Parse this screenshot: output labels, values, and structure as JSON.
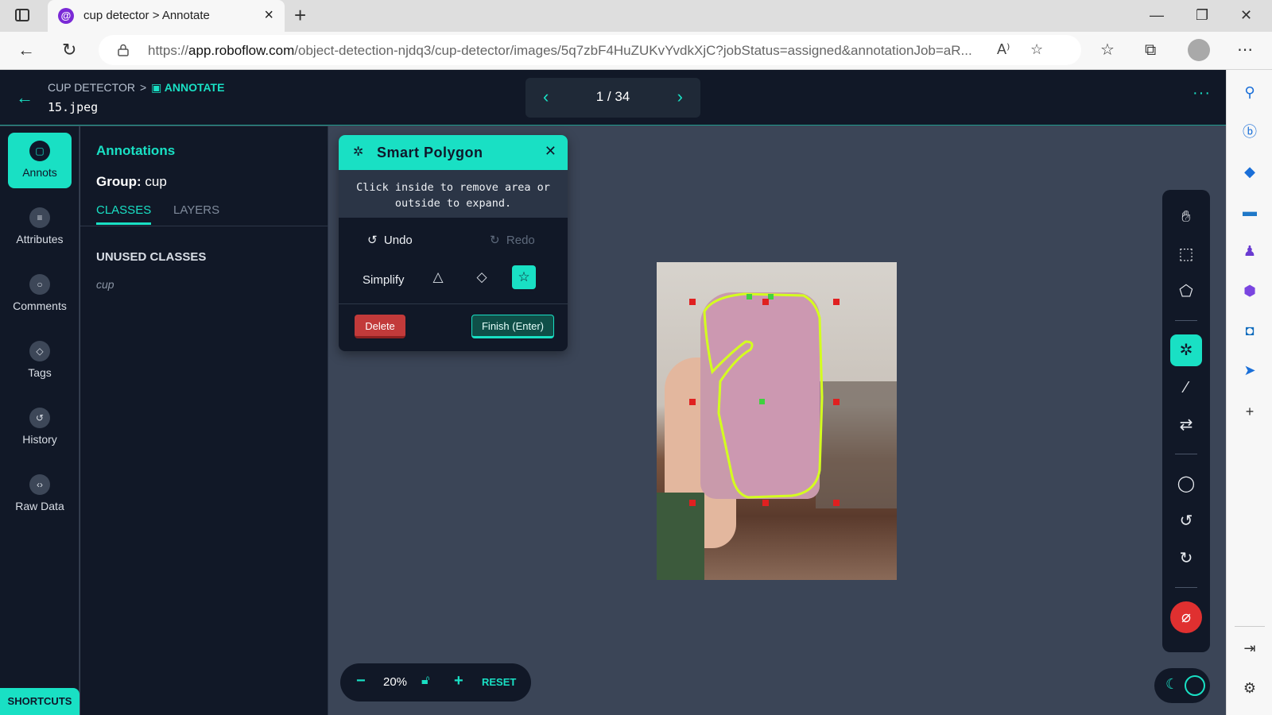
{
  "browser": {
    "tab_title": "cup detector > Annotate",
    "favicon_glyph": "@",
    "url_prefix": "https://",
    "url_host": "app.roboflow.com",
    "url_path": "/object-detection-njdq3/cup-detector/images/5q7zbF4HuZUKvYvdkXjC?jobStatus=assigned&annotationJob=aR...",
    "nav_icons": [
      "back-arrow-icon",
      "refresh-icon",
      "lock-icon"
    ],
    "window_controls": [
      "minimize",
      "restore",
      "close"
    ]
  },
  "header": {
    "project": "CUP DETECTOR",
    "separator": ">",
    "section": "ANNOTATE",
    "filename": "15.jpeg",
    "pager": "1 / 34"
  },
  "leftnav": {
    "items": [
      {
        "label": "Annots",
        "active": true
      },
      {
        "label": "Attributes",
        "active": false
      },
      {
        "label": "Comments",
        "active": false
      },
      {
        "label": "Tags",
        "active": false
      },
      {
        "label": "History",
        "active": false
      },
      {
        "label": "Raw Data",
        "active": false
      }
    ],
    "shortcuts": "SHORTCUTS"
  },
  "panel": {
    "title": "Annotations",
    "group_label": "Group:",
    "group_value": "cup",
    "tabs": [
      "CLASSES",
      "LAYERS"
    ],
    "unused_heading": "UNUSED CLASSES",
    "classes": [
      "cup"
    ]
  },
  "smart_polygon": {
    "title": "Smart Polygon",
    "message_line1": "Click inside to remove area or",
    "message_line2": "outside to expand.",
    "undo": "Undo",
    "redo": "Redo",
    "simplify": "Simplify",
    "delete": "Delete",
    "finish": "Finish (Enter)"
  },
  "zoom": {
    "value": "20%",
    "reset": "RESET"
  },
  "colors": {
    "accent": "#19e0c4",
    "header_bg": "#111827",
    "canvas_bg": "#3b4557",
    "danger": "#e03030"
  },
  "toolbar_icons": [
    "hand-icon",
    "bounding-box-icon",
    "polygon-icon",
    "smart-polygon-icon",
    "magic-wand-icon",
    "repeat-icon",
    "comment-icon",
    "undo-icon",
    "redo-icon",
    "hide-icon"
  ],
  "edge_sidebar_icons": [
    "search-icon",
    "bing-icon",
    "tag-icon",
    "toolbox-icon",
    "people-icon",
    "copilot-icon",
    "outlook-icon",
    "send-icon",
    "add-icon",
    "sidebar-toggle-icon",
    "settings-icon"
  ]
}
